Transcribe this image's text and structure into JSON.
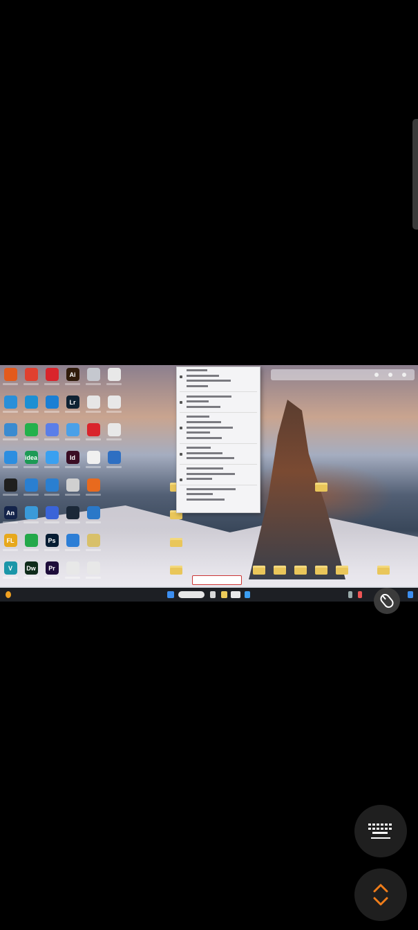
{
  "colors": {
    "background": "#000000",
    "accent": "#f07d1a",
    "taskbar": "#1d1f24",
    "menu_bg": "#f4f4f6"
  },
  "desktop": {
    "apps": [
      {
        "icon": "office-icon",
        "color": "#e35a1c",
        "label": ""
      },
      {
        "icon": "pdf-icon",
        "color": "#e0402f",
        "label": ""
      },
      {
        "icon": "netease-music-icon",
        "color": "#d9242b",
        "label": ""
      },
      {
        "icon": "illustrator-icon",
        "color": "#301b0b",
        "label": "Ai"
      },
      {
        "icon": "file-icon",
        "color": "#c5c8cf",
        "label": ""
      },
      {
        "icon": "settings-icon",
        "color": "#e8e8e8",
        "label": ""
      },
      {
        "icon": "computer-icon",
        "color": "#2a8fd8",
        "label": ""
      },
      {
        "icon": "edge-icon",
        "color": "#1d8fd3",
        "label": ""
      },
      {
        "icon": "mango-icon",
        "color": "#1b7fd4",
        "label": ""
      },
      {
        "icon": "lightroom-icon",
        "color": "#0f2233",
        "label": "Lr"
      },
      {
        "icon": "document-icon",
        "color": "#e6e6e6",
        "label": ""
      },
      {
        "icon": "settings-icon",
        "color": "#e8e8e8",
        "label": ""
      },
      {
        "icon": "folder-app-icon",
        "color": "#3b8bd0",
        "label": ""
      },
      {
        "icon": "wechat-icon",
        "color": "#24b14b",
        "label": ""
      },
      {
        "icon": "browser-icon",
        "color": "#5a7ee8",
        "label": ""
      },
      {
        "icon": "network-icon",
        "color": "#4aa0e8",
        "label": ""
      },
      {
        "icon": "media-icon",
        "color": "#d9242b",
        "label": ""
      },
      {
        "icon": "settings-icon",
        "color": "#e8e8e8",
        "label": ""
      },
      {
        "icon": "maps-icon",
        "color": "#2c8ee0",
        "label": ""
      },
      {
        "icon": "idea-icon",
        "color": "#1c9a55",
        "label": "idea"
      },
      {
        "icon": "window-icon",
        "color": "#3aa0f0",
        "label": ""
      },
      {
        "icon": "indesign-icon",
        "color": "#3a0d24",
        "label": "Id"
      },
      {
        "icon": "blank-icon",
        "color": "#f0f0f0",
        "label": ""
      },
      {
        "icon": "photos-icon",
        "color": "#2e6fc2",
        "label": ""
      },
      {
        "icon": "qq-icon",
        "color": "#1f1f1f",
        "label": ""
      },
      {
        "icon": "browser-icon",
        "color": "#2a7fd1",
        "label": ""
      },
      {
        "icon": "tools-icon",
        "color": "#2a7fd1",
        "label": ""
      },
      {
        "icon": "pen-icon",
        "color": "#d0d0d0",
        "label": ""
      },
      {
        "icon": "slides-icon",
        "color": "#e86a1e",
        "label": ""
      },
      {
        "icon": "none",
        "color": "transparent",
        "label": ""
      },
      {
        "icon": "animate-icon",
        "color": "#14244a",
        "label": "An"
      },
      {
        "icon": "installer-icon",
        "color": "#3a9ad9",
        "label": ""
      },
      {
        "icon": "video-icon",
        "color": "#3a64d8",
        "label": ""
      },
      {
        "icon": "steam-icon",
        "color": "#1b2838",
        "label": ""
      },
      {
        "icon": "book-icon",
        "color": "#2a78c8",
        "label": ""
      },
      {
        "icon": "none",
        "color": "transparent",
        "label": ""
      },
      {
        "icon": "fl-studio-icon",
        "color": "#e7a81c",
        "label": "FL"
      },
      {
        "icon": "wechat-pc-icon",
        "color": "#23a84a",
        "label": ""
      },
      {
        "icon": "photoshop-icon",
        "color": "#061c33",
        "label": "Ps"
      },
      {
        "icon": "cloud-icon",
        "color": "#2d7ed6",
        "label": ""
      },
      {
        "icon": "archive-icon",
        "color": "#d8c06a",
        "label": ""
      },
      {
        "icon": "none",
        "color": "transparent",
        "label": ""
      },
      {
        "icon": "vector-icon",
        "color": "#1b96a8",
        "label": "V"
      },
      {
        "icon": "dreamweaver-icon",
        "color": "#0f2b1a",
        "label": "Dw"
      },
      {
        "icon": "premiere-icon",
        "color": "#1e0d3a",
        "label": "Pr"
      },
      {
        "icon": "notes-icon",
        "color": "#e8e8e8",
        "label": ""
      },
      {
        "icon": "settings-icon",
        "color": "#e8e8e8",
        "label": ""
      },
      {
        "icon": "none",
        "color": "transparent",
        "label": ""
      }
    ]
  },
  "context_menu": {
    "item_count": 26
  },
  "controls": {
    "touch_mode_icon": "mouse-icon",
    "keyboard_icon": "keyboard-icon",
    "expand_icon": "chevrons-up-down-icon"
  }
}
